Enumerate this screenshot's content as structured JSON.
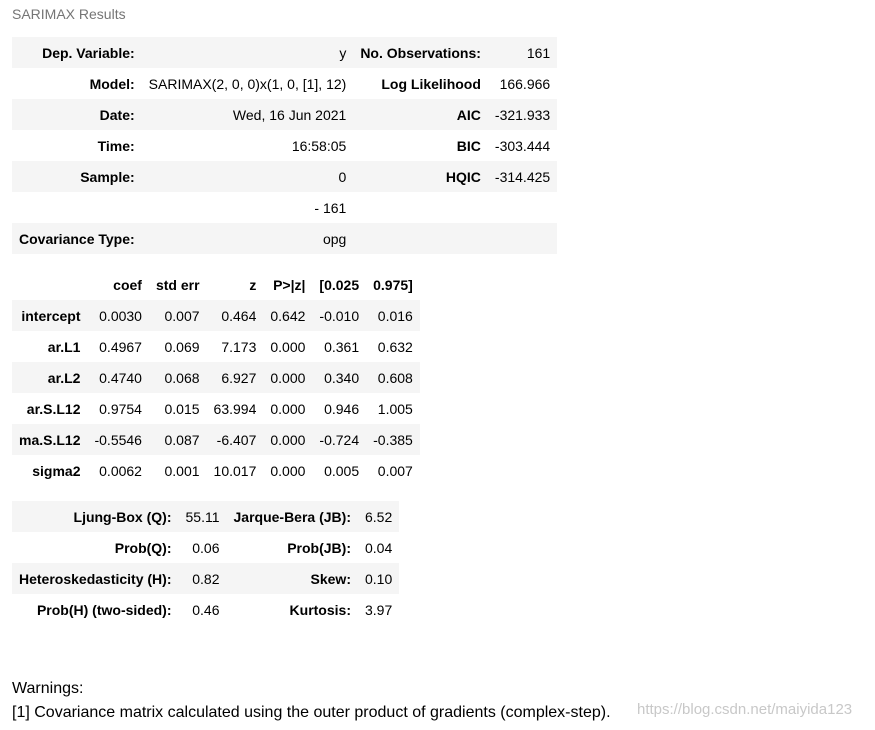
{
  "caption": "SARIMAX Results",
  "summary_rows": [
    {
      "k1": "Dep. Variable:",
      "v1": "y",
      "k2": "No. Observations:",
      "v2": "161"
    },
    {
      "k1": "Model:",
      "v1": "SARIMAX(2, 0, 0)x(1, 0, [1], 12)",
      "k2": "Log Likelihood",
      "v2": "166.966"
    },
    {
      "k1": "Date:",
      "v1": "Wed, 16 Jun 2021",
      "k2": "AIC",
      "v2": "-321.933"
    },
    {
      "k1": "Time:",
      "v1": "16:58:05",
      "k2": "BIC",
      "v2": "-303.444"
    },
    {
      "k1": "Sample:",
      "v1": "0",
      "k2": "HQIC",
      "v2": "-314.425"
    },
    {
      "k1": "",
      "v1": "- 161",
      "k2": "",
      "v2": ""
    },
    {
      "k1": "Covariance Type:",
      "v1": "opg",
      "k2": "",
      "v2": ""
    }
  ],
  "coef_headers": [
    "",
    "coef",
    "std err",
    "z",
    "P>|z|",
    "[0.025",
    "0.975]"
  ],
  "coef_rows": [
    {
      "name": "intercept",
      "coef": "0.0030",
      "se": "0.007",
      "z": "0.464",
      "p": "0.642",
      "lo": "-0.010",
      "hi": "0.016"
    },
    {
      "name": "ar.L1",
      "coef": "0.4967",
      "se": "0.069",
      "z": "7.173",
      "p": "0.000",
      "lo": "0.361",
      "hi": "0.632"
    },
    {
      "name": "ar.L2",
      "coef": "0.4740",
      "se": "0.068",
      "z": "6.927",
      "p": "0.000",
      "lo": "0.340",
      "hi": "0.608"
    },
    {
      "name": "ar.S.L12",
      "coef": "0.9754",
      "se": "0.015",
      "z": "63.994",
      "p": "0.000",
      "lo": "0.946",
      "hi": "1.005"
    },
    {
      "name": "ma.S.L12",
      "coef": "-0.5546",
      "se": "0.087",
      "z": "-6.407",
      "p": "0.000",
      "lo": "-0.724",
      "hi": "-0.385"
    },
    {
      "name": "sigma2",
      "coef": "0.0062",
      "se": "0.001",
      "z": "10.017",
      "p": "0.000",
      "lo": "0.005",
      "hi": "0.007"
    }
  ],
  "diag_rows": [
    {
      "k1": "Ljung-Box (Q):",
      "v1": "55.11",
      "k2": "Jarque-Bera (JB):",
      "v2": "6.52"
    },
    {
      "k1": "Prob(Q):",
      "v1": "0.06",
      "k2": "Prob(JB):",
      "v2": "0.04"
    },
    {
      "k1": "Heteroskedasticity (H):",
      "v1": "0.82",
      "k2": "Skew:",
      "v2": "0.10"
    },
    {
      "k1": "Prob(H) (two-sided):",
      "v1": "0.46",
      "k2": "Kurtosis:",
      "v2": "3.97"
    }
  ],
  "warnings": {
    "title": "Warnings:",
    "lines": [
      "[1] Covariance matrix calculated using the outer product of gradients (complex-step)."
    ]
  },
  "watermark": "https://blog.csdn.net/maiyida123"
}
